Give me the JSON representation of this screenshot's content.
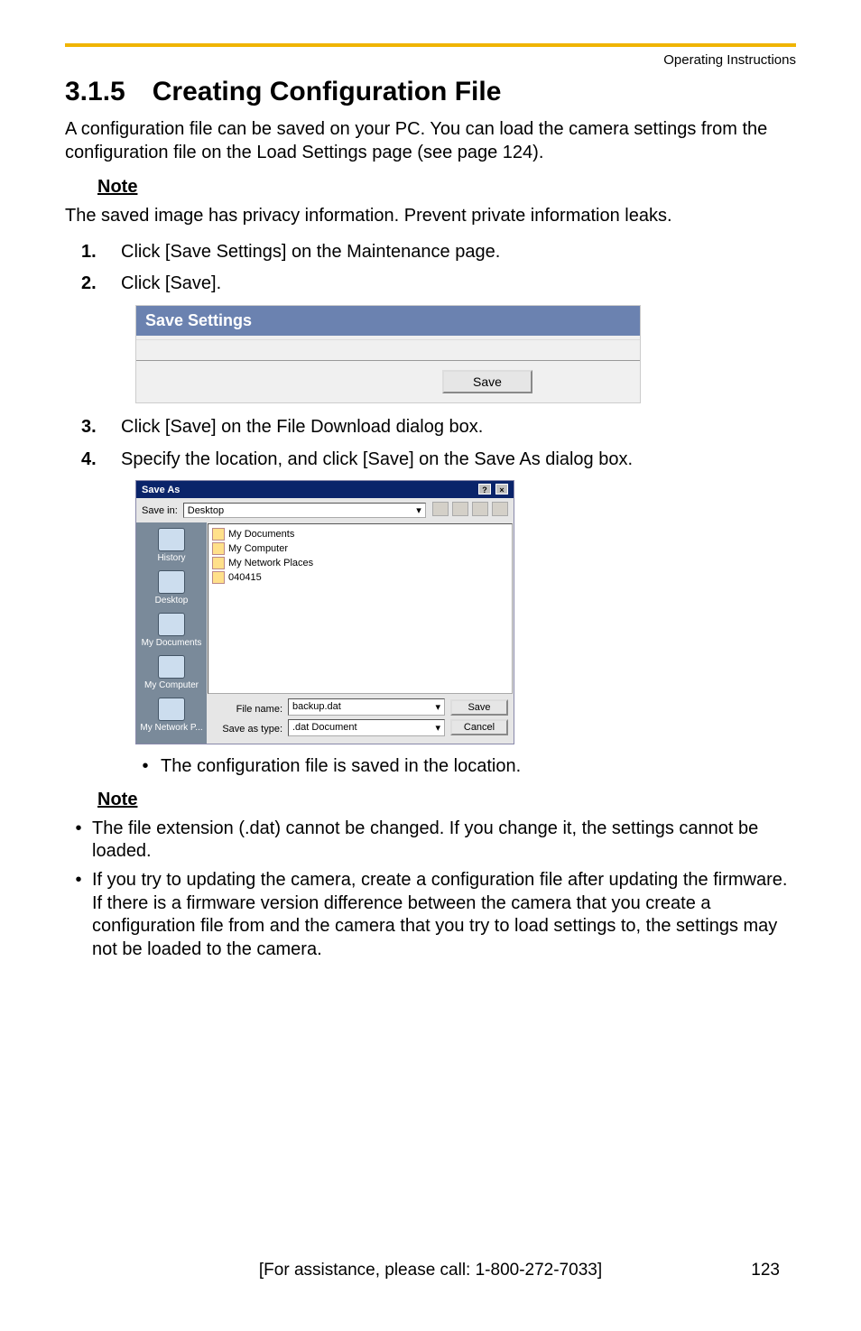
{
  "header": {
    "operating": "Operating Instructions"
  },
  "section": {
    "number": "3.1.5",
    "title": "Creating Configuration File",
    "intro": "A configuration file can be saved on your PC. You can load the camera settings from the configuration file on the Load Settings page (see page 124)."
  },
  "note1": {
    "heading": "Note",
    "text": "The saved image has privacy information. Prevent private information leaks."
  },
  "steps": {
    "s1": {
      "n": "1.",
      "t": "Click [Save Settings] on the Maintenance page."
    },
    "s2": {
      "n": "2.",
      "t": "Click [Save]."
    },
    "s3": {
      "n": "3.",
      "t": "Click [Save] on the File Download dialog box."
    },
    "s4": {
      "n": "4.",
      "t": "Specify the location, and click [Save] on the Save As dialog box."
    }
  },
  "saveSettings": {
    "title": "Save Settings",
    "button": "Save"
  },
  "saveAs": {
    "title": "Save As",
    "saveIn": "Save in:",
    "location": "Desktop",
    "sidebar": {
      "history": "History",
      "desktop": "Desktop",
      "mydocs": "My Documents",
      "mycomp": "My Computer",
      "mynet": "My Network P..."
    },
    "files": {
      "f1": "My Documents",
      "f2": "My Computer",
      "f3": "My Network Places",
      "f4": "040415"
    },
    "fileNameLbl": "File name:",
    "fileName": "backup.dat",
    "saveTypeLbl": "Save as type:",
    "saveType": ".dat Document",
    "saveBtn": "Save",
    "cancelBtn": "Cancel"
  },
  "confirm": {
    "b1": "The configuration file is saved in the location."
  },
  "note2": {
    "heading": "Note",
    "b1": "The file extension (.dat) cannot be changed. If you change it, the settings cannot be loaded.",
    "b2": "If you try to updating the camera, create a configuration file after updating the firmware. If there is a firmware version difference between the camera that you create a configuration file from and the camera that you try to load settings to, the settings may not be loaded to the camera."
  },
  "footer": {
    "assist": "[For assistance, please call: 1-800-272-7033]",
    "page": "123"
  }
}
